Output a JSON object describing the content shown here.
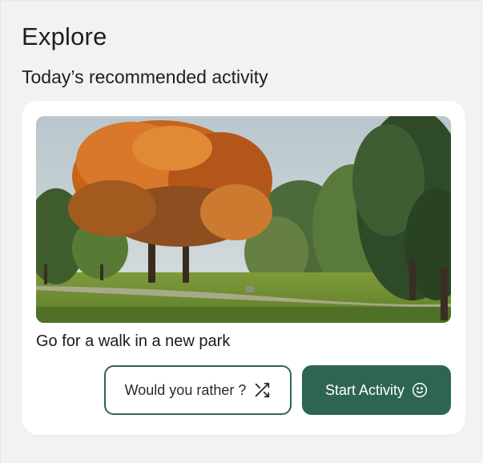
{
  "header": {
    "title": "Explore",
    "section_title": "Today’s recommended activity"
  },
  "card": {
    "activity_name": "Go for a walk in a new park",
    "image_icon": "park-photo",
    "buttons": {
      "rather_label": "Would you rather ?",
      "rather_icon": "shuffle-icon",
      "start_label": "Start Activity",
      "start_icon": "smile-icon"
    }
  },
  "colors": {
    "accent": "#2e6552",
    "background": "#f3f2f1",
    "card": "#ffffff"
  }
}
